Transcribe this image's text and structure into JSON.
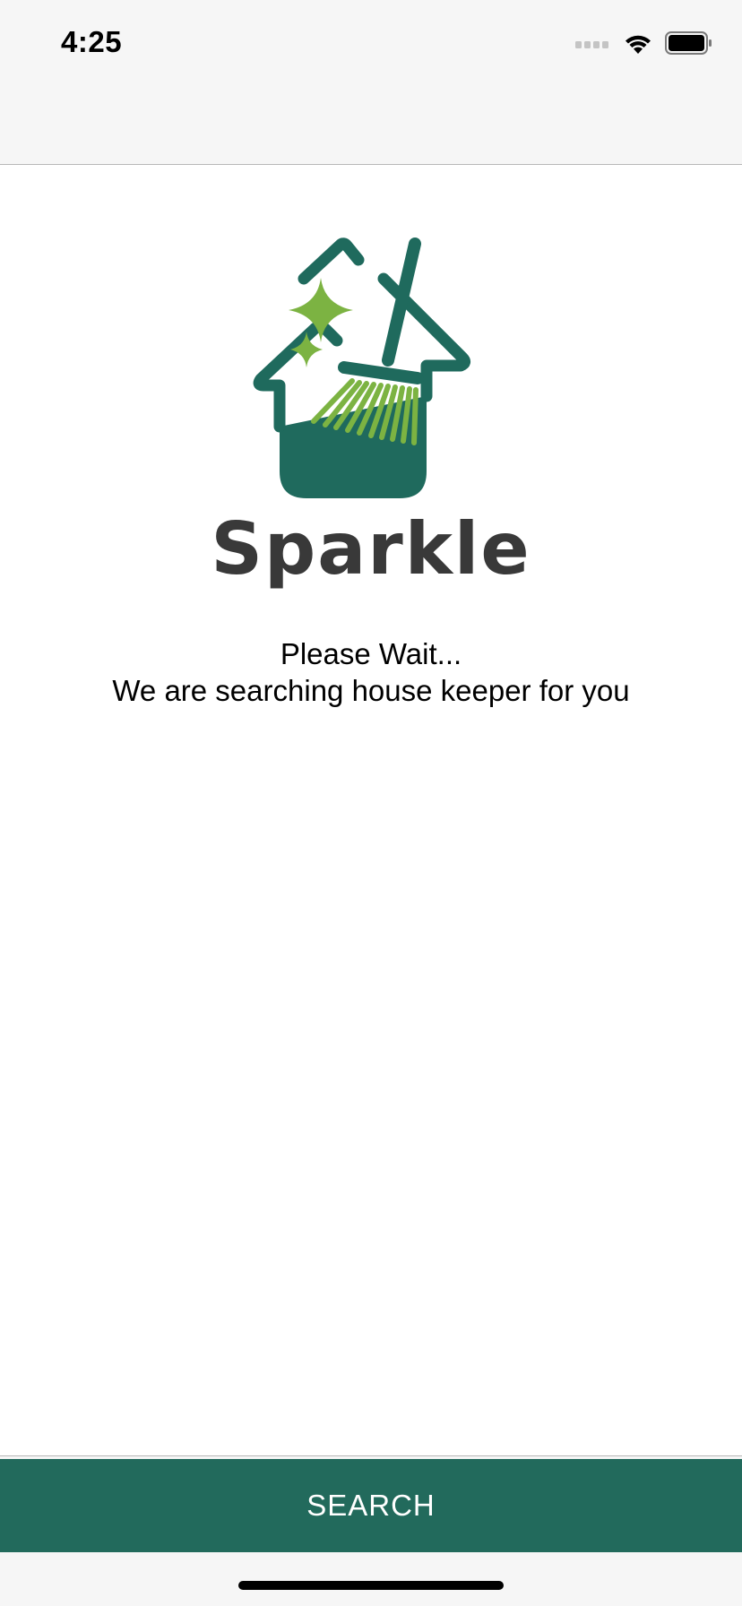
{
  "status_bar": {
    "time": "4:25",
    "icons": [
      "signal-icon",
      "wifi-icon",
      "battery-icon"
    ]
  },
  "logo": {
    "brand_name": "Sparkle",
    "icon": "house-broom-sparkle-logo",
    "colors": {
      "primary": "#1f6a5d",
      "accent": "#7cb342",
      "text": "#393939"
    }
  },
  "message": {
    "line1": "Please Wait...",
    "line2": "We are searching house keeper for you"
  },
  "actions": {
    "search_label": "SEARCH",
    "button_color": "#226a5c"
  }
}
